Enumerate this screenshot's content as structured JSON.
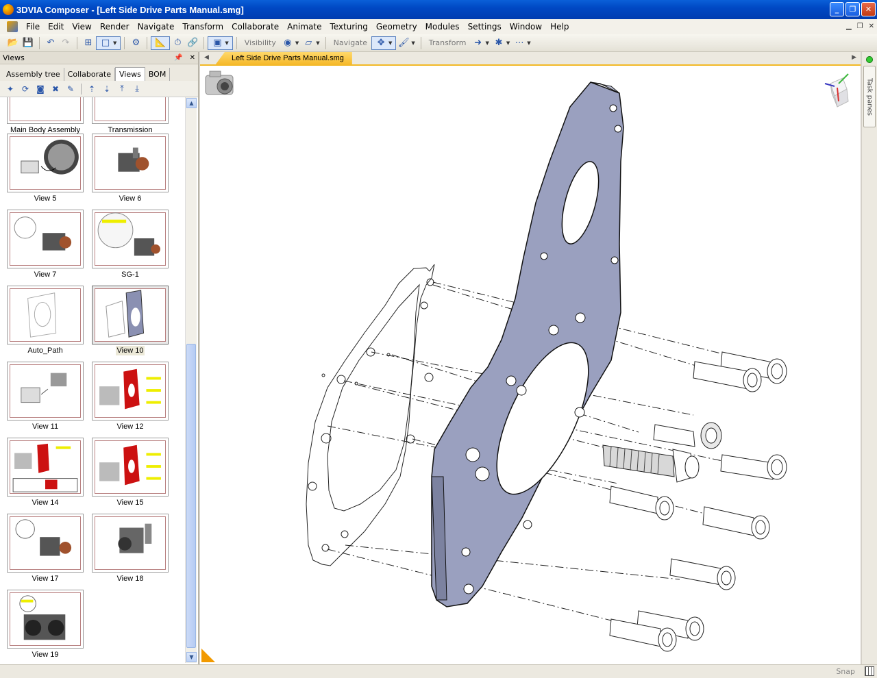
{
  "window": {
    "title": "3DVIA Composer - [Left Side Drive Parts Manual.smg]"
  },
  "menu": [
    {
      "label": "File"
    },
    {
      "label": "Edit"
    },
    {
      "label": "View"
    },
    {
      "label": "Render"
    },
    {
      "label": "Navigate"
    },
    {
      "label": "Transform"
    },
    {
      "label": "Collaborate"
    },
    {
      "label": "Animate"
    },
    {
      "label": "Texturing"
    },
    {
      "label": "Geometry"
    },
    {
      "label": "Modules"
    },
    {
      "label": "Settings"
    },
    {
      "label": "Window"
    },
    {
      "label": "Help"
    }
  ],
  "toolbar": {
    "visibility_label": "Visibility",
    "navigate_label": "Navigate",
    "transform_label": "Transform"
  },
  "left_panel": {
    "title": "Views",
    "tabs": [
      {
        "label": "Assembly tree"
      },
      {
        "label": "Collaborate"
      },
      {
        "label": "Views",
        "active": true
      },
      {
        "label": "BOM"
      }
    ],
    "views": [
      {
        "label": "Main Body Assembly"
      },
      {
        "label": "Transmission Assembly"
      },
      {
        "label": "View 5"
      },
      {
        "label": "View 6"
      },
      {
        "label": "View 7"
      },
      {
        "label": "SG-1"
      },
      {
        "label": "Auto_Path"
      },
      {
        "label": "View 10",
        "selected": true
      },
      {
        "label": "View 11"
      },
      {
        "label": "View 12"
      },
      {
        "label": "View 14"
      },
      {
        "label": "View 15"
      },
      {
        "label": "View 17"
      },
      {
        "label": "View 18"
      },
      {
        "label": "View 19"
      }
    ]
  },
  "document": {
    "tab_label": "Left Side Drive Parts Manual.smg"
  },
  "task_panes": {
    "label": "Task panes"
  },
  "status": {
    "snap_label": "Snap"
  },
  "colors": {
    "title_bar": "#0048c4",
    "doc_tab": "#f5b828",
    "plate": "#9aa0bf",
    "thumb_red": "#cc1111"
  }
}
